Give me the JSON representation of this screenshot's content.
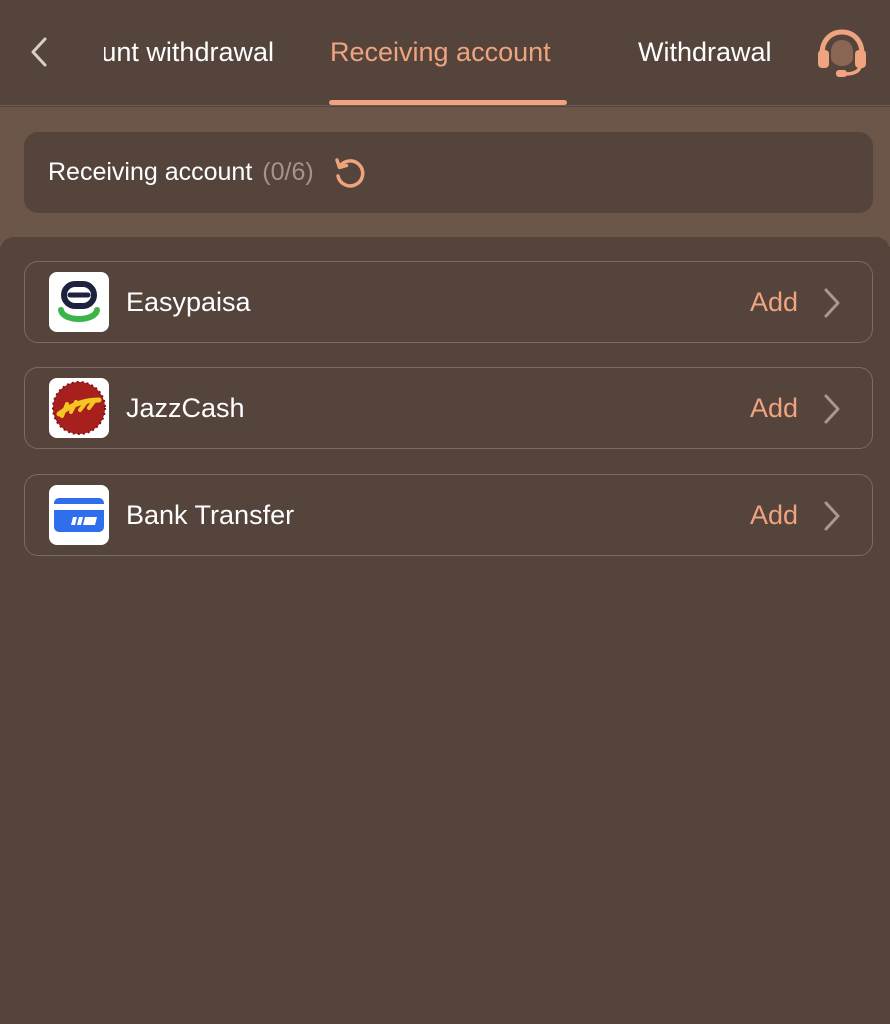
{
  "header": {
    "tabs": [
      {
        "label": "Account withdrawal",
        "active": false
      },
      {
        "label": "Receiving account",
        "active": true
      },
      {
        "label": "Withdrawal",
        "active": false
      }
    ],
    "back_icon": "chevron-left-icon",
    "support_icon": "headset-icon"
  },
  "summary": {
    "label": "Receiving account",
    "count": "(0/6)",
    "refresh_icon": "refresh-icon"
  },
  "methods": [
    {
      "name": "Easypaisa",
      "action": "Add",
      "logo": "easypaisa-logo"
    },
    {
      "name": "JazzCash",
      "action": "Add",
      "logo": "jazzcash-logo"
    },
    {
      "name": "Bank Transfer",
      "action": "Add",
      "logo": "bank-card-icon"
    }
  ],
  "colors": {
    "background": "#54443c",
    "accent": "#f0a37f",
    "band": "#6b5649",
    "text": "#ffffff",
    "muted": "#a69389"
  }
}
